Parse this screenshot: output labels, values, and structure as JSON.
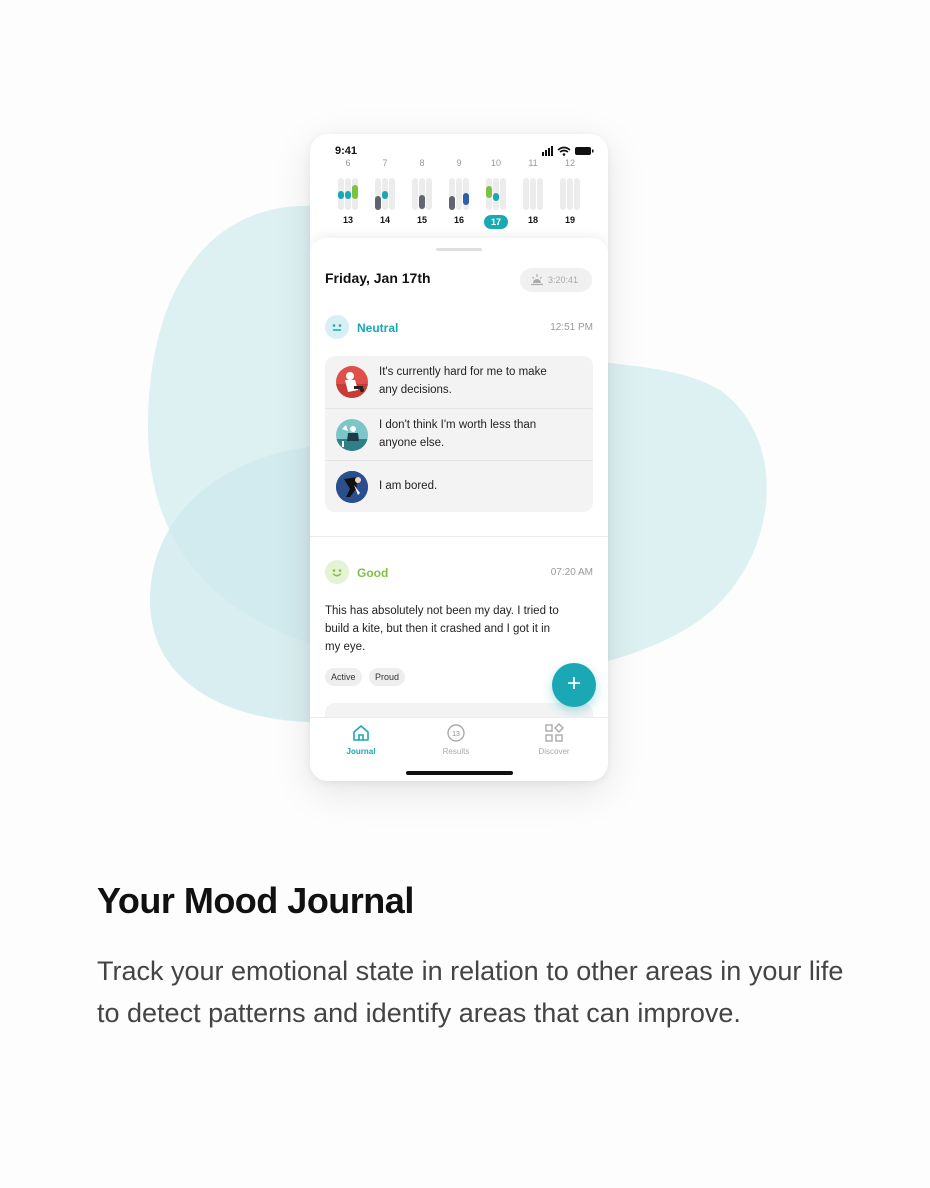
{
  "status_bar": {
    "time": "9:41"
  },
  "week_strip": {
    "days": [
      {
        "top": "6",
        "bottom": "13",
        "selected": false
      },
      {
        "top": "7",
        "bottom": "14",
        "selected": false
      },
      {
        "top": "8",
        "bottom": "15",
        "selected": false
      },
      {
        "top": "9",
        "bottom": "16",
        "selected": false
      },
      {
        "top": "10",
        "bottom": "17",
        "selected": true
      },
      {
        "top": "11",
        "bottom": "18",
        "selected": false
      },
      {
        "top": "12",
        "bottom": "19",
        "selected": false
      }
    ]
  },
  "entry": {
    "date_title": "Friday, Jan 17th",
    "sleep_value": "3:20:41",
    "moods": [
      {
        "label": "Neutral",
        "time": "12:51 PM",
        "color": "#1aa8b5",
        "face_bg": "#d8f0f3"
      },
      {
        "label": "Good",
        "time": "07:20 AM",
        "color": "#7cc242",
        "face_bg": "#e3f3d3"
      }
    ],
    "thoughts": [
      {
        "text_line1": "It's currently hard for me to make",
        "text_line2": "any decisions.",
        "icon": "thinking-figure-icon"
      },
      {
        "text_line1": "I don't think I'm worth less than",
        "text_line2": "anyone else.",
        "icon": "beach-figure-icon"
      },
      {
        "text_line1": "I am bored.",
        "text_line2": "",
        "icon": "leaning-figure-icon"
      }
    ],
    "note_lines": [
      "This has absolutely not been my day. I tried to",
      "build a kite, but then it crashed and I got it in",
      "my eye."
    ],
    "tags": [
      "Active",
      "Proud"
    ],
    "fab_label": "+"
  },
  "tabbar": {
    "tabs": [
      {
        "label": "Journal",
        "icon": "home-icon",
        "active": true
      },
      {
        "label": "Results",
        "icon": "results-badge-icon",
        "badge": "13",
        "active": false
      },
      {
        "label": "Discover",
        "icon": "discover-grid-icon",
        "active": false
      }
    ]
  },
  "marketing": {
    "heading": "Your Mood Journal",
    "description": "Track your emotional state in relation to other areas in your life to detect patterns and identify areas that can improve."
  },
  "colors": {
    "accent": "#1aa8b5",
    "good": "#7cc242",
    "dark_mark": "#5f6470",
    "blue_mark": "#2f5ea8",
    "blob": "#d6eef0"
  }
}
